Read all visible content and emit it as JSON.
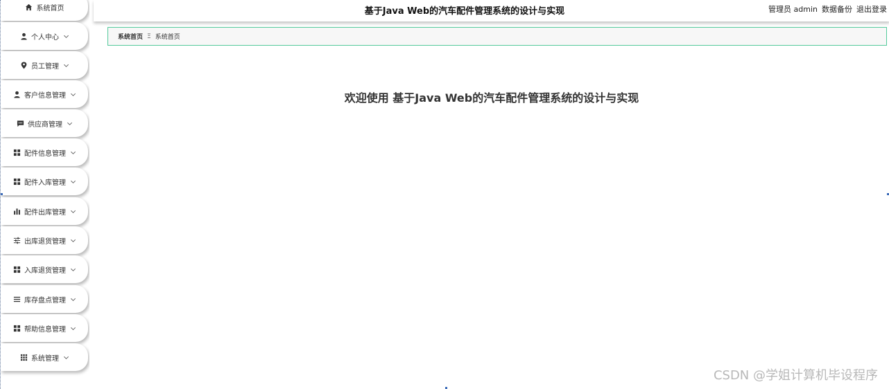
{
  "header": {
    "title": "基于Java Web的汽车配件管理系统的设计与实现",
    "user_label": "管理员 admin",
    "backup_link": "数据备份",
    "logout_link": "退出登录"
  },
  "sidebar": {
    "items": [
      {
        "label": "系统首页",
        "icon": "home-icon",
        "has_chevron": false
      },
      {
        "label": "个人中心",
        "icon": "person-icon",
        "has_chevron": true
      },
      {
        "label": "员工管理",
        "icon": "pin-icon",
        "has_chevron": true
      },
      {
        "label": "客户信息管理",
        "icon": "person-icon",
        "has_chevron": true
      },
      {
        "label": "供应商管理",
        "icon": "message-icon",
        "has_chevron": true
      },
      {
        "label": "配件信息管理",
        "icon": "grid-icon",
        "has_chevron": true
      },
      {
        "label": "配件入库管理",
        "icon": "grid-icon",
        "has_chevron": true
      },
      {
        "label": "配件出库管理",
        "icon": "bar-chart-icon",
        "has_chevron": true
      },
      {
        "label": "出库退货管理",
        "icon": "sliders-icon",
        "has_chevron": true
      },
      {
        "label": "入库退货管理",
        "icon": "grid-icon",
        "has_chevron": true
      },
      {
        "label": "库存盘点管理",
        "icon": "list-icon",
        "has_chevron": true
      },
      {
        "label": "帮助信息管理",
        "icon": "grid-icon",
        "has_chevron": true
      },
      {
        "label": "系统管理",
        "icon": "apps-icon",
        "has_chevron": true
      }
    ]
  },
  "breadcrumb": {
    "home": "系统首页",
    "separator": "Ξ",
    "current": "系统首页"
  },
  "main": {
    "welcome": "欢迎使用 基于Java Web的汽车配件管理系统的设计与实现"
  },
  "watermark": "CSDN @学姐计算机毕设程序"
}
